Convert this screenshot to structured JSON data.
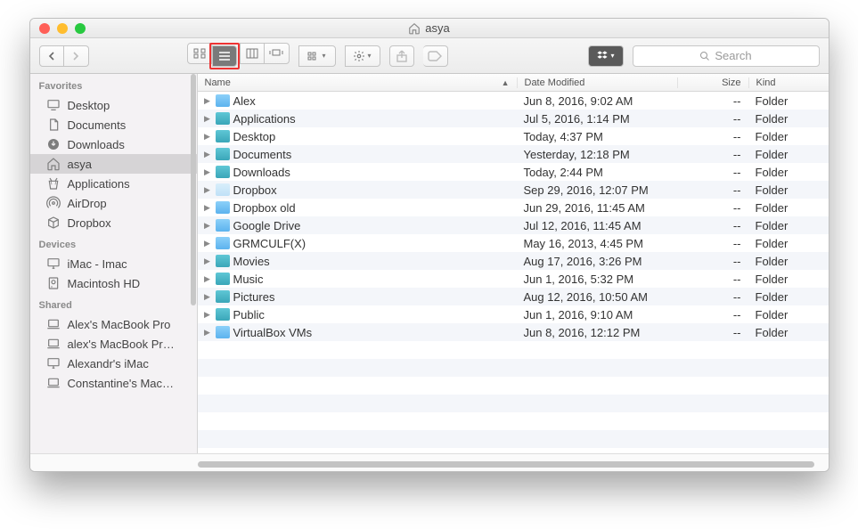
{
  "window": {
    "title": "asya"
  },
  "toolbar": {
    "search_placeholder": "Search"
  },
  "sidebar": {
    "sections": [
      {
        "label": "Favorites",
        "items": [
          {
            "icon": "display",
            "label": "Desktop"
          },
          {
            "icon": "doc",
            "label": "Documents"
          },
          {
            "icon": "down",
            "label": "Downloads"
          },
          {
            "icon": "home",
            "label": "asya",
            "selected": true
          },
          {
            "icon": "apps",
            "label": "Applications"
          },
          {
            "icon": "airdrop",
            "label": "AirDrop"
          },
          {
            "icon": "box",
            "label": "Dropbox"
          }
        ]
      },
      {
        "label": "Devices",
        "items": [
          {
            "icon": "imac",
            "label": "iMac - Imac"
          },
          {
            "icon": "hdd",
            "label": "Macintosh HD"
          }
        ]
      },
      {
        "label": "Shared",
        "items": [
          {
            "icon": "laptop",
            "label": "Alex's MacBook Pro"
          },
          {
            "icon": "laptop",
            "label": "alex's MacBook Pr…"
          },
          {
            "icon": "imac",
            "label": "Alexandr's iMac"
          },
          {
            "icon": "laptop",
            "label": "Constantine's Mac…"
          }
        ]
      }
    ]
  },
  "columns": {
    "name": "Name",
    "date": "Date Modified",
    "size": "Size",
    "kind": "Kind",
    "sort": "name",
    "arrow": "▲"
  },
  "rows": [
    {
      "name": "Alex",
      "color": "blue",
      "date": "Jun 8, 2016, 9:02 AM",
      "size": "--",
      "kind": "Folder"
    },
    {
      "name": "Applications",
      "color": "teal",
      "date": "Jul 5, 2016, 1:14 PM",
      "size": "--",
      "kind": "Folder"
    },
    {
      "name": "Desktop",
      "color": "teal",
      "date": "Today, 4:37 PM",
      "size": "--",
      "kind": "Folder"
    },
    {
      "name": "Documents",
      "color": "teal",
      "date": "Yesterday, 12:18 PM",
      "size": "--",
      "kind": "Folder"
    },
    {
      "name": "Downloads",
      "color": "teal",
      "date": "Today, 2:44 PM",
      "size": "--",
      "kind": "Folder"
    },
    {
      "name": "Dropbox",
      "color": "lt",
      "date": "Sep 29, 2016, 12:07 PM",
      "size": "--",
      "kind": "Folder"
    },
    {
      "name": "Dropbox old",
      "color": "blue",
      "date": "Jun 29, 2016, 11:45 AM",
      "size": "--",
      "kind": "Folder"
    },
    {
      "name": "Google Drive",
      "color": "blue",
      "date": "Jul 12, 2016, 11:45 AM",
      "size": "--",
      "kind": "Folder"
    },
    {
      "name": "GRMCULF(X)",
      "color": "blue",
      "date": "May 16, 2013, 4:45 PM",
      "size": "--",
      "kind": "Folder"
    },
    {
      "name": "Movies",
      "color": "teal",
      "date": "Aug 17, 2016, 3:26 PM",
      "size": "--",
      "kind": "Folder"
    },
    {
      "name": "Music",
      "color": "teal",
      "date": "Jun 1, 2016, 5:32 PM",
      "size": "--",
      "kind": "Folder"
    },
    {
      "name": "Pictures",
      "color": "teal",
      "date": "Aug 12, 2016, 10:50 AM",
      "size": "--",
      "kind": "Folder"
    },
    {
      "name": "Public",
      "color": "teal",
      "date": "Jun 1, 2016, 9:10 AM",
      "size": "--",
      "kind": "Folder"
    },
    {
      "name": "VirtualBox VMs",
      "color": "blue",
      "date": "Jun 8, 2016, 12:12 PM",
      "size": "--",
      "kind": "Folder"
    }
  ]
}
